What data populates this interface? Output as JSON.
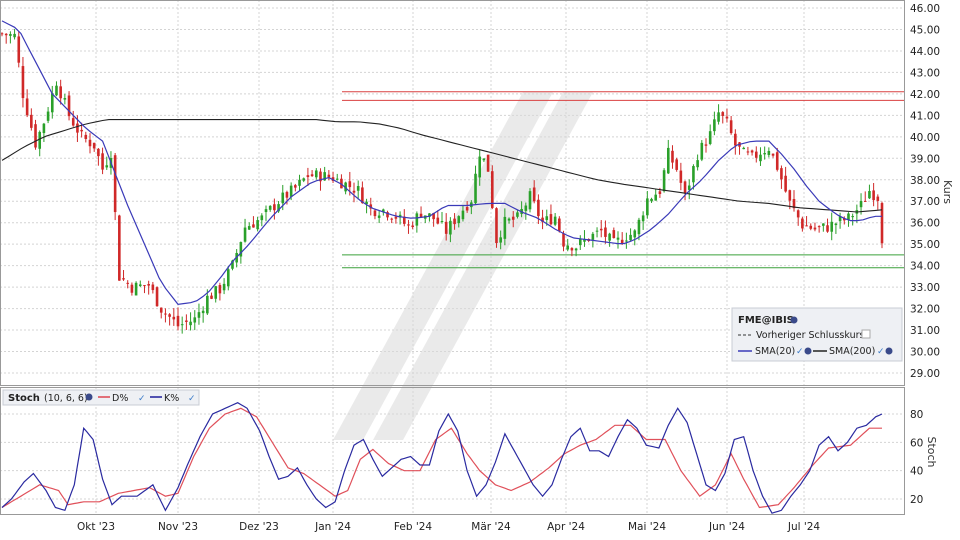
{
  "chart_data": [
    {
      "type": "candlestick",
      "symbol": "FME@IBIS",
      "ylabel": "Kurs",
      "ylim": [
        28.3,
        46.3
      ],
      "y_ticks": [
        "29.00",
        "30.00",
        "31.00",
        "32.00",
        "33.00",
        "34.00",
        "35.00",
        "36.00",
        "37.00",
        "38.00",
        "39.00",
        "40.00",
        "41.00",
        "42.00",
        "43.00",
        "44.00",
        "45.00",
        "46.00"
      ],
      "x_ticks": [
        "Okt '23",
        "Nov '23",
        "Dez '23",
        "Jan '24",
        "Feb '24",
        "Mär '24",
        "Apr '24",
        "Mai '24",
        "Jun '24",
        "Jul '24"
      ],
      "legend": {
        "title": "FME@IBIS",
        "previous_close": "Vorheriger Schlusskurs",
        "sma20": "SMA(20)",
        "sma200": "SMA(200)"
      },
      "reference_lines": [
        {
          "value": 42.1,
          "color": "#d94040"
        },
        {
          "value": 41.7,
          "color": "#d94040"
        },
        {
          "value": 34.5,
          "color": "#3aa03a"
        },
        {
          "value": 33.9,
          "color": "#3aa03a"
        }
      ],
      "price_anchors": [
        [
          0,
          44.8
        ],
        [
          6,
          44.7
        ],
        [
          10,
          42.0
        ],
        [
          16,
          39.7
        ],
        [
          20,
          40.7
        ],
        [
          26,
          42.6
        ],
        [
          32,
          41.0
        ],
        [
          38,
          40.0
        ],
        [
          44,
          39.6
        ],
        [
          48,
          38.5
        ],
        [
          52,
          39.3
        ],
        [
          56,
          33.5
        ],
        [
          62,
          33.0
        ],
        [
          70,
          33.1
        ],
        [
          76,
          32.0
        ],
        [
          84,
          31.2
        ],
        [
          92,
          31.5
        ],
        [
          98,
          32.5
        ],
        [
          104,
          32.9
        ],
        [
          110,
          34.0
        ],
        [
          116,
          35.8
        ],
        [
          124,
          36.2
        ],
        [
          132,
          37.0
        ],
        [
          140,
          37.6
        ],
        [
          146,
          38.2
        ],
        [
          152,
          38.2
        ],
        [
          158,
          38.1
        ],
        [
          164,
          37.8
        ],
        [
          170,
          37.5
        ],
        [
          176,
          36.6
        ],
        [
          182,
          36.6
        ],
        [
          188,
          36.3
        ],
        [
          194,
          35.8
        ],
        [
          200,
          36.5
        ],
        [
          206,
          36.2
        ],
        [
          212,
          35.6
        ],
        [
          218,
          36.4
        ],
        [
          224,
          37.1
        ],
        [
          228,
          39.3
        ],
        [
          232,
          38.5
        ],
        [
          236,
          35.2
        ],
        [
          240,
          36.0
        ],
        [
          246,
          36.2
        ],
        [
          252,
          37.2
        ],
        [
          258,
          36.0
        ],
        [
          264,
          36.3
        ],
        [
          268,
          35.1
        ],
        [
          274,
          34.9
        ],
        [
          280,
          35.3
        ],
        [
          286,
          35.6
        ],
        [
          292,
          35.0
        ],
        [
          298,
          35.4
        ],
        [
          302,
          35.5
        ],
        [
          308,
          37.1
        ],
        [
          314,
          37.5
        ],
        [
          318,
          39.2
        ],
        [
          322,
          38.5
        ],
        [
          326,
          37.2
        ],
        [
          332,
          39.2
        ],
        [
          338,
          40.1
        ],
        [
          342,
          41.1
        ],
        [
          346,
          40.6
        ],
        [
          350,
          39.6
        ],
        [
          354,
          39.2
        ],
        [
          358,
          39.0
        ],
        [
          362,
          39.3
        ],
        [
          366,
          39.5
        ],
        [
          370,
          38.6
        ],
        [
          376,
          36.9
        ],
        [
          382,
          35.9
        ],
        [
          388,
          35.7
        ],
        [
          394,
          35.8
        ],
        [
          398,
          36.0
        ],
        [
          404,
          36.2
        ],
        [
          410,
          36.8
        ],
        [
          414,
          37.5
        ],
        [
          418,
          37.2
        ],
        [
          420,
          35.3
        ]
      ],
      "sma20_anchors": [
        [
          0,
          45.4
        ],
        [
          8,
          45.0
        ],
        [
          16,
          43.5
        ],
        [
          24,
          42.0
        ],
        [
          32,
          41.2
        ],
        [
          40,
          40.4
        ],
        [
          48,
          39.8
        ],
        [
          54,
          38.3
        ],
        [
          60,
          36.8
        ],
        [
          68,
          35.0
        ],
        [
          76,
          33.2
        ],
        [
          84,
          32.2
        ],
        [
          92,
          32.3
        ],
        [
          98,
          32.7
        ],
        [
          104,
          33.4
        ],
        [
          110,
          34.2
        ],
        [
          118,
          35.0
        ],
        [
          128,
          36.2
        ],
        [
          138,
          37.2
        ],
        [
          148,
          37.9
        ],
        [
          156,
          38.1
        ],
        [
          162,
          37.8
        ],
        [
          170,
          37.1
        ],
        [
          176,
          36.7
        ],
        [
          182,
          36.5
        ],
        [
          188,
          36.3
        ],
        [
          196,
          36.2
        ],
        [
          204,
          36.3
        ],
        [
          212,
          36.8
        ],
        [
          222,
          36.8
        ],
        [
          232,
          36.9
        ],
        [
          240,
          36.9
        ],
        [
          248,
          36.5
        ],
        [
          256,
          36.2
        ],
        [
          264,
          35.7
        ],
        [
          272,
          35.3
        ],
        [
          280,
          35.2
        ],
        [
          288,
          35.1
        ],
        [
          296,
          35.0
        ],
        [
          302,
          35.2
        ],
        [
          310,
          35.7
        ],
        [
          318,
          36.4
        ],
        [
          326,
          37.3
        ],
        [
          334,
          38.0
        ],
        [
          342,
          38.9
        ],
        [
          350,
          39.6
        ],
        [
          358,
          39.8
        ],
        [
          366,
          39.8
        ],
        [
          372,
          39.2
        ],
        [
          378,
          38.5
        ],
        [
          384,
          37.7
        ],
        [
          390,
          37.0
        ],
        [
          398,
          36.4
        ],
        [
          404,
          36.1
        ],
        [
          410,
          36.1
        ],
        [
          416,
          36.3
        ],
        [
          420,
          36.3
        ]
      ],
      "sma200_anchors": [
        [
          0,
          38.9
        ],
        [
          10,
          39.5
        ],
        [
          20,
          40.0
        ],
        [
          30,
          40.3
        ],
        [
          40,
          40.6
        ],
        [
          50,
          40.8
        ],
        [
          60,
          40.8
        ],
        [
          80,
          40.8
        ],
        [
          100,
          40.8
        ],
        [
          120,
          40.8
        ],
        [
          140,
          40.8
        ],
        [
          150,
          40.8
        ],
        [
          160,
          40.7
        ],
        [
          170,
          40.7
        ],
        [
          180,
          40.6
        ],
        [
          190,
          40.4
        ],
        [
          200,
          40.1
        ],
        [
          212,
          39.8
        ],
        [
          224,
          39.5
        ],
        [
          236,
          39.2
        ],
        [
          248,
          38.9
        ],
        [
          260,
          38.6
        ],
        [
          272,
          38.3
        ],
        [
          284,
          38.0
        ],
        [
          296,
          37.8
        ],
        [
          310,
          37.6
        ],
        [
          324,
          37.4
        ],
        [
          338,
          37.2
        ],
        [
          352,
          37.0
        ],
        [
          366,
          36.9
        ],
        [
          380,
          36.7
        ],
        [
          394,
          36.6
        ],
        [
          408,
          36.5
        ],
        [
          420,
          36.6
        ]
      ]
    },
    {
      "type": "line",
      "title": "Stoch",
      "params": "(10, 6, 6)",
      "ylabel": "Stoch",
      "ylim": [
        0,
        92
      ],
      "y_ticks": [
        "20",
        "40",
        "60",
        "80"
      ],
      "series": [
        {
          "name": "D%",
          "color": "#e0505a",
          "anchors": [
            [
              0,
              14
            ],
            [
              12,
              22
            ],
            [
              24,
              30
            ],
            [
              36,
              26
            ],
            [
              42,
              16
            ],
            [
              52,
              18
            ],
            [
              62,
              18
            ],
            [
              74,
              24
            ],
            [
              84,
              26
            ],
            [
              94,
              28
            ],
            [
              104,
              22
            ],
            [
              112,
              24
            ],
            [
              122,
              50
            ],
            [
              132,
              70
            ],
            [
              142,
              80
            ],
            [
              152,
              84
            ],
            [
              162,
              78
            ],
            [
              172,
              60
            ],
            [
              182,
              42
            ],
            [
              192,
              38
            ],
            [
              202,
              30
            ],
            [
              212,
              22
            ],
            [
              220,
              26
            ],
            [
              228,
              48
            ],
            [
              236,
              55
            ],
            [
              246,
              45
            ],
            [
              256,
              40
            ],
            [
              266,
              40
            ],
            [
              276,
              62
            ],
            [
              286,
              70
            ],
            [
              296,
              52
            ],
            [
              304,
              40
            ],
            [
              314,
              30
            ],
            [
              324,
              26
            ],
            [
              336,
              32
            ],
            [
              348,
              42
            ],
            [
              358,
              52
            ],
            [
              368,
              58
            ],
            [
              378,
              62
            ],
            [
              390,
              72
            ],
            [
              400,
              72
            ],
            [
              410,
              62
            ],
            [
              422,
              62
            ],
            [
              432,
              40
            ],
            [
              444,
              22
            ],
            [
              454,
              30
            ],
            [
              464,
              52
            ],
            [
              472,
              34
            ],
            [
              482,
              14
            ],
            [
              494,
              16
            ],
            [
              504,
              28
            ],
            [
              516,
              44
            ],
            [
              526,
              56
            ],
            [
              540,
              58
            ],
            [
              552,
              70
            ],
            [
              560,
              70
            ]
          ]
        },
        {
          "name": "K%",
          "color": "#2a2aa0",
          "anchors": [
            [
              0,
              14
            ],
            [
              6,
              20
            ],
            [
              14,
              32
            ],
            [
              20,
              38
            ],
            [
              28,
              26
            ],
            [
              34,
              14
            ],
            [
              40,
              12
            ],
            [
              46,
              30
            ],
            [
              52,
              70
            ],
            [
              58,
              62
            ],
            [
              64,
              34
            ],
            [
              70,
              16
            ],
            [
              76,
              22
            ],
            [
              86,
              22
            ],
            [
              96,
              30
            ],
            [
              104,
              12
            ],
            [
              112,
              28
            ],
            [
              118,
              44
            ],
            [
              126,
              64
            ],
            [
              134,
              80
            ],
            [
              142,
              84
            ],
            [
              150,
              88
            ],
            [
              156,
              84
            ],
            [
              164,
              68
            ],
            [
              170,
              50
            ],
            [
              176,
              34
            ],
            [
              182,
              36
            ],
            [
              188,
              42
            ],
            [
              194,
              30
            ],
            [
              200,
              20
            ],
            [
              206,
              14
            ],
            [
              212,
              18
            ],
            [
              218,
              40
            ],
            [
              224,
              58
            ],
            [
              230,
              62
            ],
            [
              236,
              48
            ],
            [
              242,
              36
            ],
            [
              248,
              42
            ],
            [
              254,
              48
            ],
            [
              260,
              50
            ],
            [
              266,
              44
            ],
            [
              272,
              44
            ],
            [
              278,
              68
            ],
            [
              284,
              80
            ],
            [
              290,
              68
            ],
            [
              296,
              40
            ],
            [
              302,
              22
            ],
            [
              308,
              30
            ],
            [
              314,
              46
            ],
            [
              320,
              66
            ],
            [
              326,
              54
            ],
            [
              332,
              42
            ],
            [
              338,
              30
            ],
            [
              344,
              22
            ],
            [
              350,
              30
            ],
            [
              356,
              48
            ],
            [
              362,
              64
            ],
            [
              368,
              70
            ],
            [
              374,
              54
            ],
            [
              380,
              54
            ],
            [
              386,
              50
            ],
            [
              392,
              64
            ],
            [
              398,
              76
            ],
            [
              404,
              70
            ],
            [
              410,
              58
            ],
            [
              418,
              56
            ],
            [
              424,
              72
            ],
            [
              430,
              84
            ],
            [
              436,
              74
            ],
            [
              442,
              52
            ],
            [
              448,
              30
            ],
            [
              454,
              26
            ],
            [
              460,
              38
            ],
            [
              466,
              62
            ],
            [
              472,
              64
            ],
            [
              478,
              40
            ],
            [
              484,
              22
            ],
            [
              490,
              10
            ],
            [
              496,
              12
            ],
            [
              502,
              22
            ],
            [
              508,
              30
            ],
            [
              514,
              40
            ],
            [
              520,
              58
            ],
            [
              526,
              64
            ],
            [
              532,
              54
            ],
            [
              538,
              60
            ],
            [
              544,
              70
            ],
            [
              550,
              72
            ],
            [
              556,
              78
            ],
            [
              560,
              80
            ]
          ]
        }
      ]
    }
  ]
}
